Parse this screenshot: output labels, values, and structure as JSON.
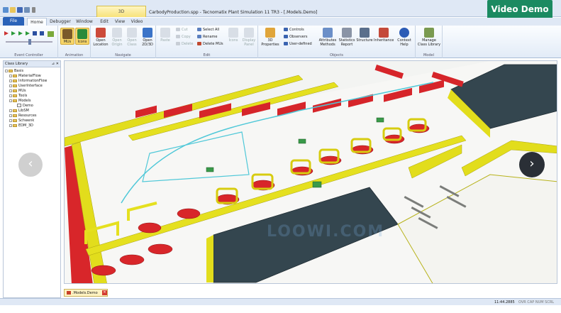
{
  "window": {
    "title": "CarbodyProduction.spp - Tecnomatix Plant Simulation 11 TR3 - [.Models.Demo]",
    "context_tab": "3D"
  },
  "overlay": {
    "video_demo": "Video Demo",
    "prev": "‹",
    "next": "›",
    "watermark": "LOOWI.COM"
  },
  "ribbon": {
    "file": "File",
    "tabs": [
      "Home",
      "Debugger",
      "Window",
      "Edit",
      "View",
      "Video"
    ],
    "groups": {
      "event_controller": "Event Controller",
      "animation": "Animation",
      "navigate": "Navigate",
      "edit": "Edit",
      "objects": "Objects",
      "model": "Model"
    },
    "buttons": {
      "mus": "MUs",
      "icons": "Icons",
      "open_location": "Open Location",
      "open_origin": "Open Origin",
      "open_class": "Open Class",
      "open_2d3d": "Open 2D/3D",
      "paste": "Paste",
      "cut": "Cut",
      "copy": "Copy",
      "delete": "Delete",
      "select_all": "Select All",
      "rename": "Rename",
      "delete_mus": "Delete MUs",
      "icons2": "Icons",
      "display_panel": "Display Panel",
      "properties_3d": "3D Properties",
      "controls": "Controls",
      "observers": "Observers",
      "user_defined": "User-defined",
      "attributes_methods": "Attributes Methods",
      "statistics_report": "Statistics Report",
      "structure": "Structure",
      "inheritance": "Inheritance",
      "context_help": "Context Help",
      "manage_class_library": "Manage Class Library"
    }
  },
  "panel": {
    "title": "Class Library",
    "items": [
      {
        "label": "Basis",
        "level": 0,
        "type": "folder"
      },
      {
        "label": "MaterialFlow",
        "level": 1,
        "type": "folder"
      },
      {
        "label": "InformationFlow",
        "level": 1,
        "type": "folder"
      },
      {
        "label": "UserInterface",
        "level": 1,
        "type": "folder"
      },
      {
        "label": "MUs",
        "level": 1,
        "type": "folder"
      },
      {
        "label": "Tools",
        "level": 1,
        "type": "folder"
      },
      {
        "label": "Models",
        "level": 1,
        "type": "folder"
      },
      {
        "label": "Demo",
        "level": 2,
        "type": "frame"
      },
      {
        "label": "LibSM",
        "level": 1,
        "type": "folder"
      },
      {
        "label": "Resources",
        "level": 1,
        "type": "folder"
      },
      {
        "label": "Schwenk",
        "level": 1,
        "type": "folder"
      },
      {
        "label": "EDM_3D",
        "level": 1,
        "type": "folder"
      }
    ]
  },
  "document_tab": ".Models.Demo",
  "status": {
    "time": "11:44.2885",
    "keys": "OVR CAP NUM SCRL"
  },
  "colors": {
    "ribbon_bg": "#dfe8f5",
    "file_tab": "#2a62b8",
    "video_demo": "#1b8a61",
    "car_red": "#d8262a",
    "wall_yellow": "#e6e01a",
    "building_dark": "#34464f"
  }
}
